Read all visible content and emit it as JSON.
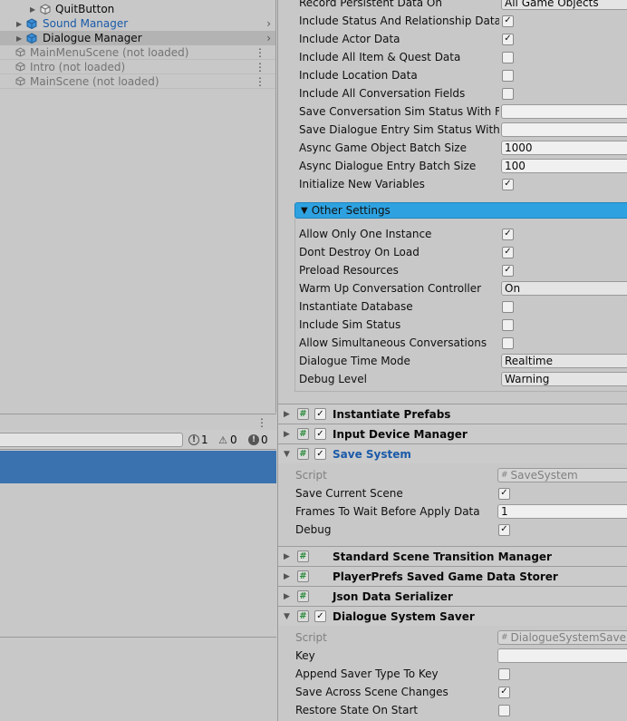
{
  "hierarchy": {
    "items": [
      {
        "label": "QuitButton",
        "indent": 2,
        "kind": "child"
      },
      {
        "label": "Sound Manager",
        "indent": 1,
        "kind": "prefab"
      },
      {
        "label": "Dialogue Manager",
        "indent": 1,
        "kind": "prefab"
      },
      {
        "label": "MainMenuScene (not loaded)",
        "kind": "scene"
      },
      {
        "label": "Intro (not loaded)",
        "kind": "scene"
      },
      {
        "label": "MainScene (not loaded)",
        "kind": "scene"
      }
    ]
  },
  "console": {
    "info_count": "1",
    "warn_count": "0",
    "error_count": "0"
  },
  "inspector": {
    "persistent": [
      {
        "label": "Record Persistent Data On",
        "type": "dropdown",
        "value": "All Game Objects"
      },
      {
        "label": "Include Status And Relationship Data",
        "type": "check",
        "checked": true
      },
      {
        "label": "Include Actor Data",
        "type": "check",
        "checked": true
      },
      {
        "label": "Include All Item & Quest Data",
        "type": "check",
        "checked": false
      },
      {
        "label": "Include Location Data",
        "type": "check",
        "checked": false
      },
      {
        "label": "Include All Conversation Fields",
        "type": "check",
        "checked": false
      },
      {
        "label": "Save Conversation Sim Status With Fiel",
        "type": "field",
        "value": ""
      },
      {
        "label": "Save Dialogue Entry Sim Status With Fie",
        "type": "field",
        "value": ""
      },
      {
        "label": "Async Game Object Batch Size",
        "type": "field",
        "value": "1000"
      },
      {
        "label": "Async Dialogue Entry Batch Size",
        "type": "field",
        "value": "100"
      },
      {
        "label": "Initialize New Variables",
        "type": "check",
        "checked": true
      }
    ],
    "other_settings_title": "Other Settings",
    "other_settings": [
      {
        "label": "Allow Only One Instance",
        "type": "check",
        "checked": true
      },
      {
        "label": "Dont Destroy On Load",
        "type": "check",
        "checked": true
      },
      {
        "label": "Preload Resources",
        "type": "check",
        "checked": true
      },
      {
        "label": "Warm Up Conversation Controller",
        "type": "dropdown",
        "value": "On"
      },
      {
        "label": "Instantiate Database",
        "type": "check",
        "checked": false
      },
      {
        "label": "Include Sim Status",
        "type": "check",
        "checked": false
      },
      {
        "label": "Allow Simultaneous Conversations",
        "type": "check",
        "checked": false
      },
      {
        "label": "Dialogue Time Mode",
        "type": "dropdown",
        "value": "Realtime"
      },
      {
        "label": "Debug Level",
        "type": "dropdown",
        "value": "Warning"
      }
    ],
    "components": {
      "instantiate_prefabs": "Instantiate Prefabs",
      "input_device_manager": "Input Device Manager",
      "save_system": "Save System",
      "standard_scene_transition_manager": "Standard Scene Transition Manager",
      "playerprefs_saved_game_data_storer": "PlayerPrefs Saved Game Data Storer",
      "json_data_serializer": "Json Data Serializer",
      "dialogue_system_saver": "Dialogue System Saver"
    },
    "save_system_props": [
      {
        "label": "Script",
        "type": "script",
        "value": "SaveSystem"
      },
      {
        "label": "Save Current Scene",
        "type": "check",
        "checked": true
      },
      {
        "label": "Frames To Wait Before Apply Data",
        "type": "field",
        "value": "1"
      },
      {
        "label": "Debug",
        "type": "check",
        "checked": true
      }
    ],
    "saver_props": [
      {
        "label": "Script",
        "type": "script",
        "value": "DialogueSystemSaver"
      },
      {
        "label": "Key",
        "type": "field",
        "value": ""
      },
      {
        "label": "Append Saver Type To Key",
        "type": "check",
        "checked": false
      },
      {
        "label": "Save Across Scene Changes",
        "type": "check",
        "checked": true
      },
      {
        "label": "Restore State On Start",
        "type": "check",
        "checked": false
      }
    ]
  },
  "icons": {
    "check": "✓",
    "hash": "#",
    "fold_open": "▼",
    "fold_closed": "▶",
    "kebab": "⋮",
    "chevron": "›",
    "script_hash": "#"
  }
}
